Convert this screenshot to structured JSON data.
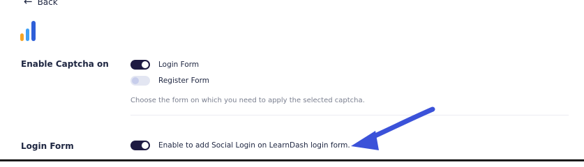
{
  "nav": {
    "back_label": "Back",
    "back_arrow": "←"
  },
  "captcha_section": {
    "label": "Enable Captcha on",
    "options": [
      {
        "label": "Login Form",
        "enabled": true
      },
      {
        "label": "Register Form",
        "enabled": false
      }
    ],
    "help_text": "Choose the form on which you need to apply the selected captcha."
  },
  "login_section": {
    "label": "Login Form",
    "toggle_label": "Enable to add Social Login on LearnDash login form.",
    "enabled": true
  },
  "colors": {
    "logo_orange": "#f5a524",
    "logo_blue_light": "#3fa0f5",
    "logo_blue": "#2e5fd8",
    "toggle_on": "#1e1a42",
    "toggle_off": "#e3e6f2",
    "annotation_arrow": "#3b52d9"
  },
  "icons": {
    "logo": "bar-chart-logo",
    "pointer": "annotation-arrow"
  }
}
